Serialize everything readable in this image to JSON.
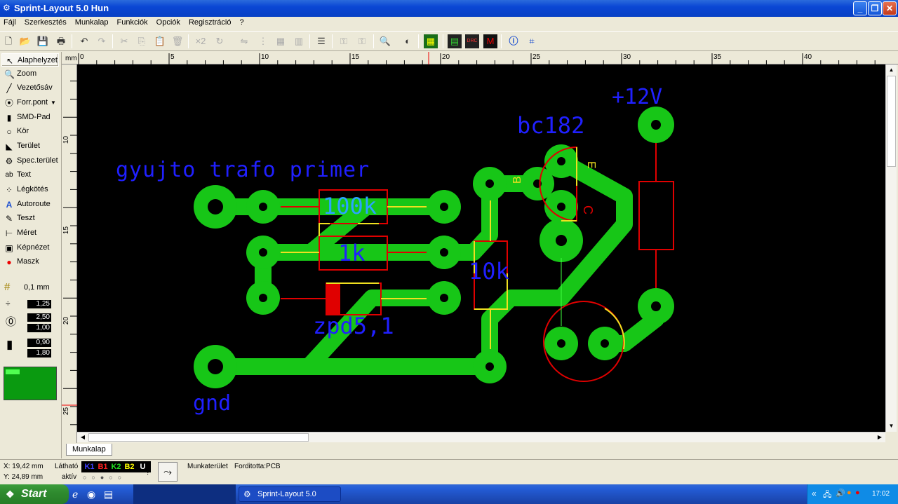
{
  "window": {
    "title": "Sprint-Layout 5.0 Hun"
  },
  "menu": [
    "Fájl",
    "Szerkesztés",
    "Munkalap",
    "Funkciók",
    "Opciók",
    "Regisztráció",
    "?"
  ],
  "left_tools": [
    {
      "label": "Alaphelyzet",
      "icon": "arrow-icon"
    },
    {
      "label": "Zoom",
      "icon": "magnifier-icon"
    },
    {
      "label": "Vezetősáv",
      "icon": "track-icon"
    },
    {
      "label": "Forr.pont",
      "icon": "pad-icon"
    },
    {
      "label": "SMD-Pad",
      "icon": "smd-icon"
    },
    {
      "label": "Kör",
      "icon": "circle-icon"
    },
    {
      "label": "Terület",
      "icon": "area-icon"
    },
    {
      "label": "Spec.terület",
      "icon": "special-area-icon"
    },
    {
      "label": "Text",
      "icon": "text-icon"
    },
    {
      "label": "Légkötés",
      "icon": "airwire-icon"
    },
    {
      "label": "Autoroute",
      "icon": "autoroute-icon"
    },
    {
      "label": "Teszt",
      "icon": "test-icon"
    },
    {
      "label": "Méret",
      "icon": "measure-icon"
    },
    {
      "label": "Képnézet",
      "icon": "photoview-icon"
    },
    {
      "label": "Maszk",
      "icon": "mask-icon"
    }
  ],
  "grid": {
    "label": "0,1 mm"
  },
  "params": {
    "track_width": "1,25",
    "pad_outer": "2,50",
    "pad_inner": "1,00",
    "smd_w": "0,90",
    "smd_h": "1,80"
  },
  "ruler": {
    "unit": "mm",
    "top_ticks": [
      "0",
      "5",
      "10",
      "15",
      "20",
      "25",
      "30",
      "35",
      "40"
    ],
    "left_ticks": [
      "10",
      "15",
      "20",
      "25"
    ]
  },
  "labels": {
    "gyujto": "gyujto trafo primer",
    "v12": "+12V",
    "bc182": "bc182",
    "r100k": "100k",
    "r1k": "1k",
    "r10k": "10k",
    "zpd": "zpd5,1",
    "gnd": "gnd",
    "pin_e": "E",
    "pin_b": "B",
    "pin_c": "C"
  },
  "colors": {
    "copper": "#17c617",
    "silk": "#e00000",
    "label": "#2020ff",
    "canvas": "#000000"
  },
  "tab": {
    "label": "Munkalap"
  },
  "status": {
    "x": "X:  19,42 mm",
    "y": "Y:  24,89 mm",
    "visible_label": "Látható",
    "active_label": "aktív",
    "layers": [
      {
        "name": "K1",
        "color": "#4040ff"
      },
      {
        "name": "B1",
        "color": "#ff2020"
      },
      {
        "name": "K2",
        "color": "#20e020"
      },
      {
        "name": "B2",
        "color": "#ffff00"
      },
      {
        "name": "U",
        "color": "#ffffff"
      }
    ],
    "q": "?",
    "workspace": "Munkaterület",
    "translated": "Forditotta:PCB"
  },
  "taskbar": {
    "start": "Start",
    "task": "Sprint-Layout 5.0",
    "clock": "17:02"
  }
}
